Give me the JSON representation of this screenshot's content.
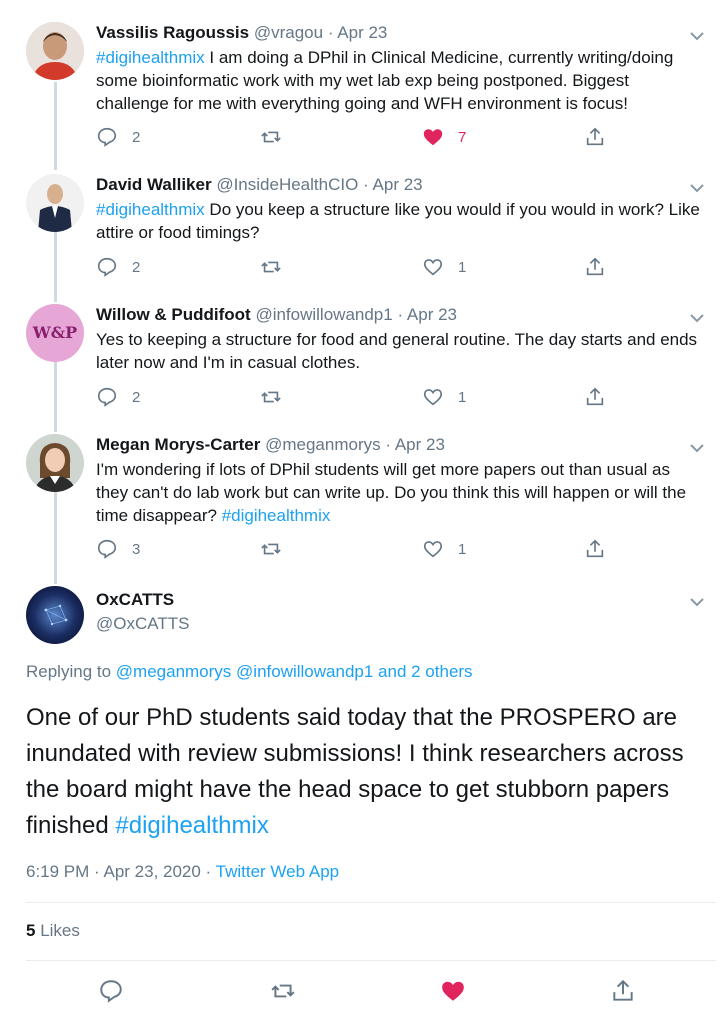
{
  "thread": [
    {
      "name": "Vassilis Ragoussis",
      "handle": "@vragou",
      "sep": "·",
      "date": "Apr 23",
      "hashtag": "#digihealthmix",
      "text": " I am doing a DPhil in Clinical Medicine, currently writing/doing some bioinformatic work with my wet lab exp being postponed. Biggest challenge for me with everything going and WFH environment is focus!",
      "replies": "2",
      "likes": "7",
      "liked": true
    },
    {
      "name": "David Walliker",
      "handle": "@InsideHealthCIO",
      "sep": "·",
      "date": "Apr 23",
      "hashtag": "#digihealthmix",
      "text": " Do you keep a structure like you would if you would in work? Like attire or food timings?",
      "replies": "2",
      "likes": "1",
      "liked": false
    },
    {
      "name": "Willow & Puddifoot",
      "handle": "@infowillowandp1",
      "sep": "·",
      "date": "Apr 23",
      "text": "Yes to keeping a structure for food and general routine. The day starts and ends later now and I'm in casual clothes.",
      "replies": "2",
      "likes": "1",
      "liked": false,
      "avatar_text": "W&P"
    },
    {
      "name": "Megan Morys-Carter",
      "handle": "@meganmorys",
      "sep": "·",
      "date": "Apr 23",
      "text": "I'm wondering if lots of DPhil students will get more papers out than usual as they can't do lab work but can write up.  Do you think this will happen or will the time disappear? ",
      "hashtag_end": "#digihealthmix",
      "replies": "3",
      "likes": "1",
      "liked": false
    }
  ],
  "focus": {
    "name": "OxCATTS",
    "handle": "@OxCATTS",
    "replying_prefix": "Replying to ",
    "mention1": "@meganmorys",
    "mention2": "@infowillowandp1",
    "mention_more": "and 2 others",
    "text": "One of our PhD students said today that the PROSPERO are inundated with review submissions! I think researchers across the board might have the head space to get stubborn papers finished ",
    "hashtag": "#digihealthmix",
    "time": "6:19 PM · Apr 23, 2020 · ",
    "source": "Twitter Web App",
    "likes_count": "5",
    "likes_label": " Likes"
  },
  "colors": {
    "link": "#1da1f2",
    "like": "#e0245e",
    "muted": "#657786"
  }
}
